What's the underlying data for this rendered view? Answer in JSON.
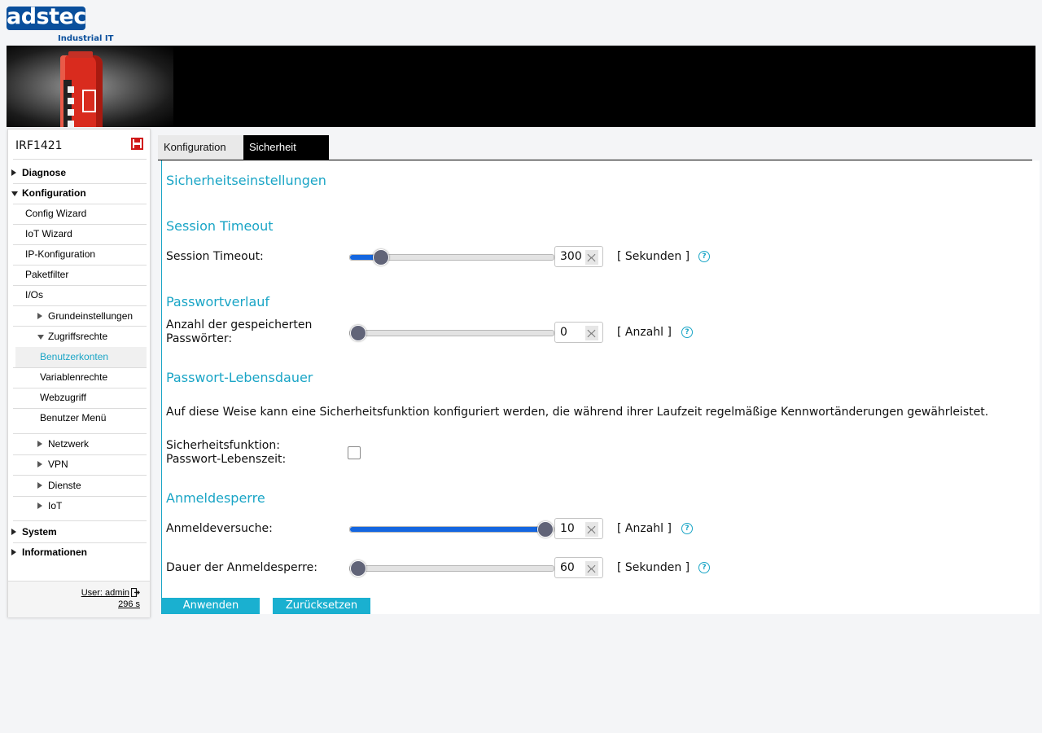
{
  "logo": {
    "text": "adstec",
    "subtitle": "Industrial IT"
  },
  "sidebar": {
    "device_name": "IRF1421",
    "items": [
      {
        "label": "Diagnose"
      },
      {
        "label": "Konfiguration"
      },
      {
        "label": "Config Wizard"
      },
      {
        "label": "IoT Wizard"
      },
      {
        "label": "IP-Konfiguration"
      },
      {
        "label": "Paketfilter"
      },
      {
        "label": "I/Os"
      },
      {
        "label": "Grundeinstellungen"
      },
      {
        "label": "Zugriffsrechte"
      },
      {
        "label": "Benutzerkonten"
      },
      {
        "label": "Variablenrechte"
      },
      {
        "label": "Webzugriff"
      },
      {
        "label": "Benutzer Menü"
      },
      {
        "label": "Netzwerk"
      },
      {
        "label": "VPN"
      },
      {
        "label": "Dienste"
      },
      {
        "label": "IoT"
      },
      {
        "label": "System"
      },
      {
        "label": "Informationen"
      }
    ],
    "footer": {
      "user": "User: admin",
      "remaining": "296 s"
    }
  },
  "tabs": [
    {
      "label": "Konfiguration"
    },
    {
      "label": "Sicherheit"
    }
  ],
  "main": {
    "title": "Sicherheitseinstellungen",
    "session_timeout": {
      "heading": "Session Timeout",
      "label": "Session Timeout:",
      "value": "300",
      "unit": "[ Sekunden ]",
      "fraction": 0.12
    },
    "password_history": {
      "heading": "Passwortverlauf",
      "label_line1": "Anzahl der gespeicherten",
      "label_line2": "Passwörter:",
      "value": "0",
      "unit": "[ Anzahl ]",
      "fraction": 0
    },
    "password_lifetime": {
      "heading": "Passwort-Lebensdauer",
      "description": "Auf diese Weise kann eine Sicherheitsfunktion konfiguriert werden, die während ihrer Laufzeit regelmäßige Kennwortänderungen gewährleistet.",
      "label_line1": "Sicherheitsfunktion:",
      "label_line2": "Passwort-Lebenszeit:",
      "checked": false
    },
    "login_lock": {
      "heading": "Anmeldesperre",
      "attempts_label": "Anmeldeversuche:",
      "attempts_value": "10",
      "attempts_unit": "[ Anzahl ]",
      "attempts_fraction": 1.0,
      "duration_label": "Dauer der Anmeldesperre:",
      "duration_value": "60",
      "duration_unit": "[ Sekunden ]",
      "duration_fraction": 0
    },
    "help_glyph": "?",
    "apply_button": "Anwenden",
    "reset_button": "Zurücksetzen"
  },
  "colors": {
    "accent": "#1aa5c6",
    "brand": "#0a4f9c",
    "slider_fill": "#1466e0"
  }
}
